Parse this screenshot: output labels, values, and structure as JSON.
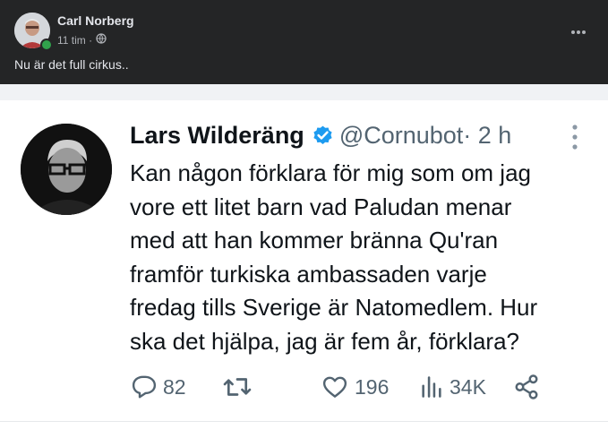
{
  "facebook_post": {
    "author": "Carl Norberg",
    "time": "11 tim ·",
    "caption": "Nu är det full cirkus.."
  },
  "tweet": {
    "name": "Lars Wilderäng",
    "handle": "@Cornubot",
    "time": " · 2 h",
    "text": "Kan någon förklara för mig som om jag\nvore ett litet barn vad Paludan menar\nmed att han kommer bränna Qu'ran\nframför turkiska ambassaden varje\nfredag tills Sverige är Natomedlem. Hur\nska det hjälpa, jag är fem år, förklara?",
    "replies": "82",
    "retweets": "",
    "likes": "196",
    "views": "34K"
  },
  "colors": {
    "fb_background": "#242526",
    "verified_blue": "#1d9bf0",
    "twitter_gray": "#536471"
  },
  "icons": [
    "globe-icon",
    "more-options-icon",
    "verified-badge-icon",
    "reply-icon",
    "retweet-icon",
    "like-icon",
    "views-icon",
    "share-icon"
  ]
}
